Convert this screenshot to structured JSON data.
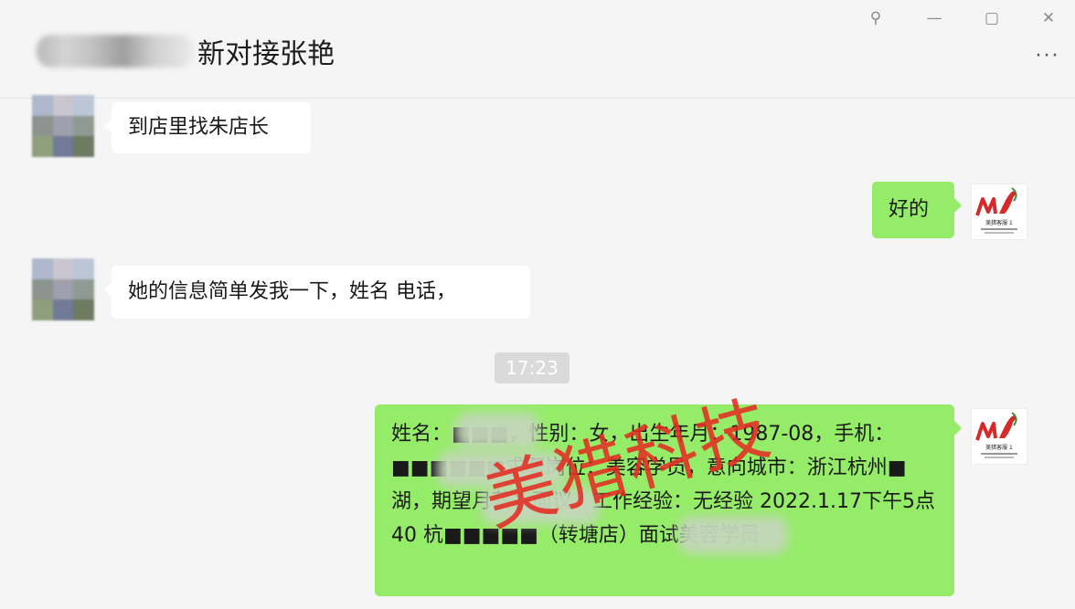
{
  "window": {
    "title": "新对接张艳",
    "controls": {
      "pin": "⚲",
      "minimize": "—",
      "maximize": "▢",
      "close": "✕"
    },
    "more": "···"
  },
  "colors": {
    "incoming_bubble": "#ffffff",
    "outgoing_bubble": "#95ec69",
    "chat_background": "#f5f5f5",
    "watermark": "#e22c22"
  },
  "messages": [
    {
      "side": "incoming",
      "text": "到店里找朱店长"
    },
    {
      "side": "outgoing",
      "text": "好的"
    },
    {
      "side": "incoming",
      "text": "她的信息简单发我一下，姓名 电话，"
    },
    {
      "side": "outgoing",
      "text": "姓名：■■■，性别：女，出生年月：1987-08，手机：■■■■■■求职岗位：美容学员，意向城市：浙江杭州■湖，期望月薪：面议，工作经验：无经验 2022.1.17下午5点40 杭■■■■■（转塘店）面试美容学员"
    }
  ],
  "timestamp": "17:23",
  "watermark": "美猎科技",
  "logo": {
    "text": "美猎客服 1"
  }
}
